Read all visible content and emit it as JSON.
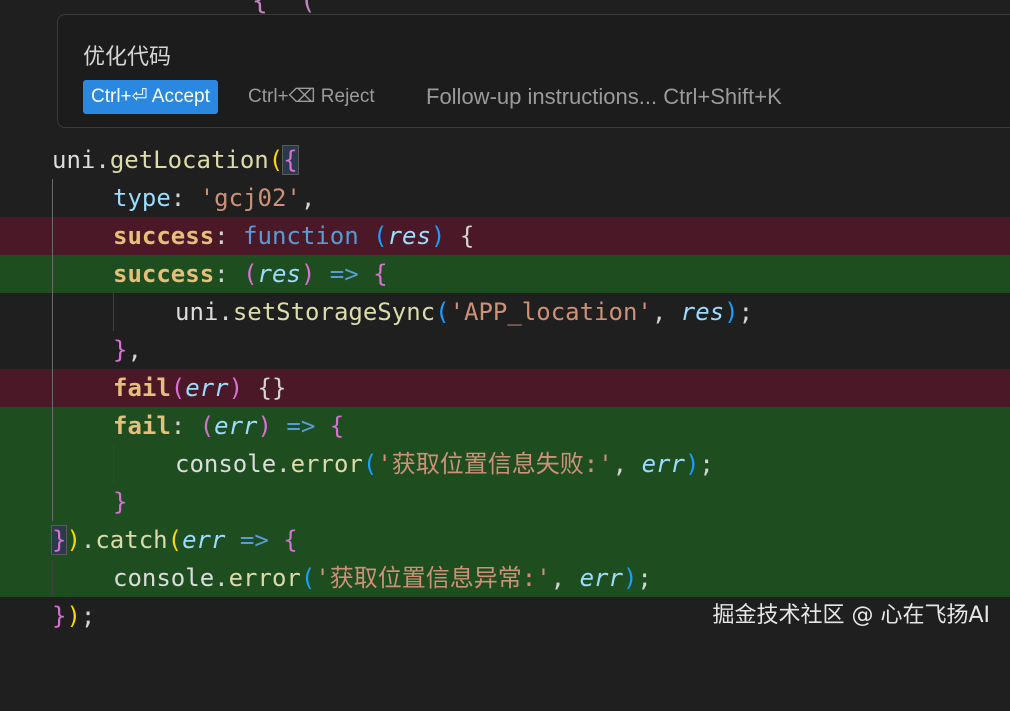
{
  "widget": {
    "title": "优化代码",
    "accept_label": "Ctrl+⏎ Accept",
    "reject_label": "Ctrl+⌫ Reject",
    "followup_placeholder": "Follow-up instructions... Ctrl+Shift+K"
  },
  "code_lines": [
    {
      "state": "normal",
      "text": "uni.getLocation({"
    },
    {
      "state": "normal",
      "text": "    type: 'gcj02',"
    },
    {
      "state": "removed",
      "text": "    success: function (res) {"
    },
    {
      "state": "added",
      "text": "    success: (res) => {"
    },
    {
      "state": "normal",
      "text": "        uni.setStorageSync('APP_location', res);"
    },
    {
      "state": "normal",
      "text": "    },"
    },
    {
      "state": "removed",
      "text": "    fail(err) {}"
    },
    {
      "state": "added",
      "text": "    fail: (err) => {"
    },
    {
      "state": "added",
      "text": "        console.error('获取位置信息失败:', err);"
    },
    {
      "state": "added",
      "text": "    }"
    },
    {
      "state": "added",
      "text": "}).catch(err => {"
    },
    {
      "state": "added",
      "text": "    console.error('获取位置信息异常:', err);"
    },
    {
      "state": "normal",
      "text": "});"
    }
  ],
  "watermark": "掘金技术社区 @ 心在飞扬AI",
  "colors": {
    "removed_bg": "#4b1827",
    "added_bg": "#1e4d20",
    "accent": "#2b88e0"
  }
}
